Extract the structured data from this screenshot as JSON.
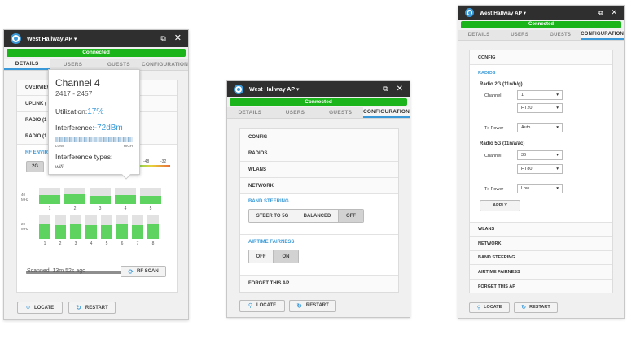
{
  "colors": {
    "accent": "#3a9ad9",
    "connected": "#1bb41b",
    "bar": "#5fd35f",
    "titlebar": "#2f2f2f"
  },
  "panel1": {
    "title": "West Hallway AP",
    "status": "Connected",
    "tabs": [
      "DETAILS",
      "USERS",
      "GUESTS",
      "CONFIGURATION"
    ],
    "sections": [
      "OVERVIEW",
      "UPLINK (",
      "RADIO (1",
      "RADIO (1"
    ],
    "rf_env_label": "RF ENVIR",
    "band_2g": "2G",
    "range_min": "-48",
    "range_max": "-32",
    "unit_40": "40 MHz",
    "unit_20": "20 MHz",
    "bars40": {
      "labels": [
        "1",
        "2",
        "3",
        "4",
        "5"
      ],
      "levels": [
        0.55,
        0.6,
        0.5,
        0.55,
        0.5
      ]
    },
    "bars20": {
      "labels": [
        "1",
        "2",
        "3",
        "4",
        "5",
        "6",
        "7",
        "8"
      ],
      "levels": [
        0.6,
        0.55,
        0.6,
        0.55,
        0.55,
        0.6,
        0.55,
        0.6
      ]
    },
    "scan_progress": 0.75,
    "scanned": "Scanned: 13m 52s ago",
    "rf_scan": "RF SCAN",
    "locate": "LOCATE",
    "restart": "RESTART",
    "tooltip": {
      "channel": "Channel 4",
      "range": "2417 - 2457",
      "util_label": "Utilization:",
      "util_value": "17%",
      "interf_label": "Interference:",
      "interf_value": "-72dBm",
      "low": "LOW",
      "high": "HIGH",
      "types_label": "Interference types:",
      "types_value": "wifi"
    }
  },
  "panel2": {
    "title": "West Hallway AP",
    "status": "Connected",
    "tabs": [
      "DETAILS",
      "USERS",
      "GUESTS",
      "CONFIGURATION"
    ],
    "sections": [
      "CONFIG",
      "RADIOS",
      "WLANS",
      "NETWORK"
    ],
    "band_steering": {
      "title": "BAND STEERING",
      "options": [
        "STEER TO 5G",
        "BALANCED",
        "OFF"
      ],
      "selected": "OFF"
    },
    "airtime": {
      "title": "AIRTIME FAIRNESS",
      "options": [
        "OFF",
        "ON"
      ],
      "selected": "ON"
    },
    "forget": "FORGET THIS AP",
    "locate": "LOCATE",
    "restart": "RESTART"
  },
  "panel3": {
    "title": "West Hallway AP",
    "status": "Connected",
    "tabs": [
      "DETAILS",
      "USERS",
      "GUESTS",
      "CONFIGURATION"
    ],
    "config": "CONFIG",
    "radios": "RADIOS",
    "radio2g": {
      "title": "Radio 2G (11n/b/g)",
      "channel_label": "Channel",
      "channel": "1",
      "width": "HT20",
      "tx_label": "Tx Power",
      "tx": "Auto"
    },
    "radio5g": {
      "title": "Radio 5G (11n/a/ac)",
      "channel_label": "Channel",
      "channel": "36",
      "width": "HT80",
      "tx_label": "Tx Power",
      "tx": "Low"
    },
    "apply": "APPLY",
    "sections": [
      "WLANS",
      "NETWORK",
      "BAND STEERING",
      "AIRTIME FAIRNESS",
      "FORGET THIS AP"
    ],
    "locate": "LOCATE",
    "restart": "RESTART"
  }
}
